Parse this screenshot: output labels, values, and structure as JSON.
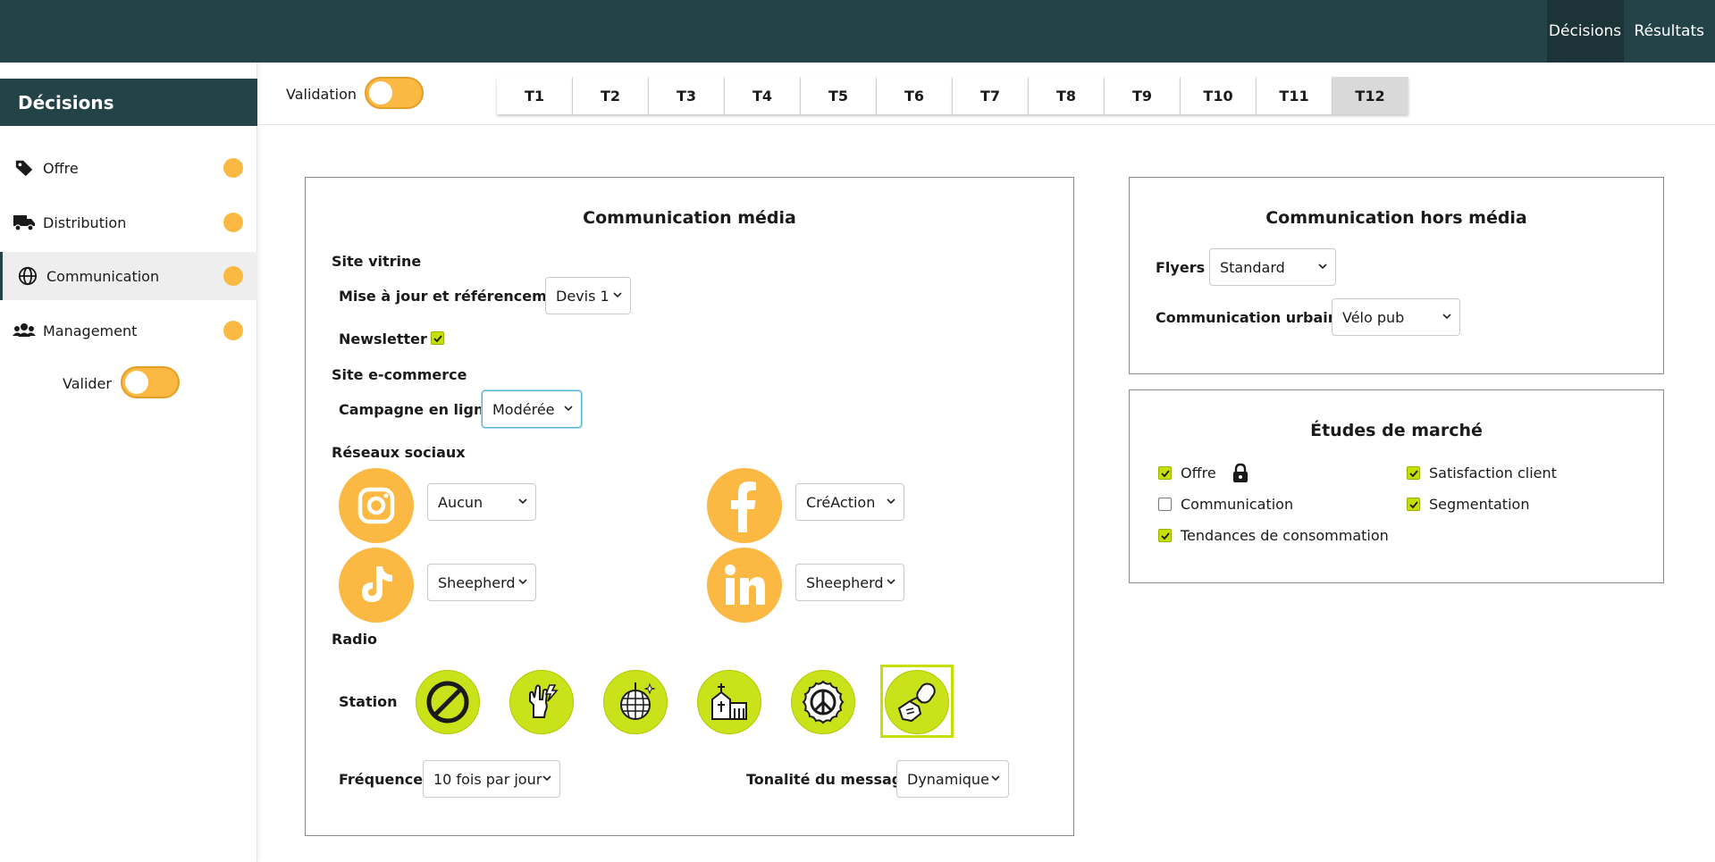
{
  "header": {
    "nav": [
      {
        "label": "Décisions",
        "active": true
      },
      {
        "label": "Résultats",
        "active": false
      }
    ]
  },
  "sidebar": {
    "title": "Décisions",
    "items": [
      {
        "label": "Offre",
        "icon": "tag-icon"
      },
      {
        "label": "Distribution",
        "icon": "truck-icon"
      },
      {
        "label": "Communication",
        "icon": "globe-icon",
        "active": true
      },
      {
        "label": "Management",
        "icon": "users-icon"
      }
    ],
    "validate_label": "Valider",
    "status_color": "#fbb944"
  },
  "toolbar": {
    "validation_label": "Validation",
    "periods": [
      "T1",
      "T2",
      "T3",
      "T4",
      "T5",
      "T6",
      "T7",
      "T8",
      "T9",
      "T10",
      "T11",
      "T12"
    ],
    "active_period": "T12"
  },
  "media": {
    "title": "Communication média",
    "site_vitrine": {
      "heading": "Site vitrine",
      "update_label": "Mise à jour et référencement",
      "update_value": "Devis 1",
      "newsletter_label": "Newsletter",
      "newsletter_checked": true
    },
    "ecommerce": {
      "heading": "Site e-commerce",
      "campaign_label": "Campagne en ligne",
      "campaign_value": "Modérée"
    },
    "social": {
      "heading": "Réseaux sociaux",
      "instagram_value": "Aucun",
      "facebook_value": "CréAction",
      "tiktok_value": "Sheepherd",
      "linkedin_value": "Sheepherd"
    },
    "radio": {
      "heading": "Radio",
      "station_label": "Station",
      "stations": [
        "none-station-icon",
        "rock-station-icon",
        "disco-station-icon",
        "religious-station-icon",
        "peace-station-icon",
        "talk-station-icon"
      ],
      "selected_station": "talk-station-icon",
      "frequency_label": "Fréquence",
      "frequency_value": "10 fois par jour",
      "tone_label": "Tonalité du message",
      "tone_value": "Dynamique"
    }
  },
  "offline": {
    "title": "Communication hors média",
    "flyers_label": "Flyers",
    "flyers_value": "Standard",
    "urban_label": "Communication urbaine",
    "urban_value": "Vélo pub"
  },
  "studies": {
    "title": "Études de marché",
    "items": [
      {
        "label": "Offre",
        "checked": true,
        "locked": true
      },
      {
        "label": "Satisfaction client",
        "checked": true
      },
      {
        "label": "Communication",
        "checked": false
      },
      {
        "label": "Segmentation",
        "checked": true
      },
      {
        "label": "Tendances de consommation",
        "checked": true
      }
    ]
  },
  "colors": {
    "header": "#234349",
    "accent": "#fbb944",
    "check": "#c5e000"
  }
}
